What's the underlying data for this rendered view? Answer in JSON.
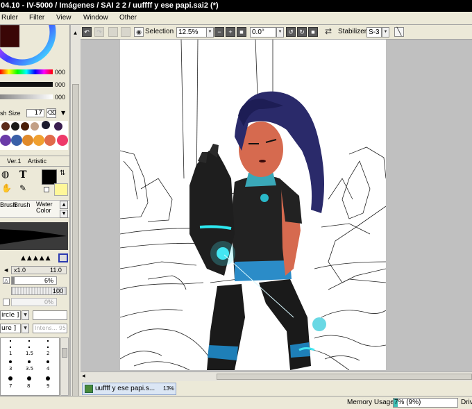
{
  "window": {
    "title": "04.10 - IV-5000 / Imágenes / SAI 2 2 / uuffff y ese papi.sai2 (*)"
  },
  "menu": {
    "items": [
      "Ruler",
      "Filter",
      "View",
      "Window",
      "Other"
    ]
  },
  "toolbar": {
    "selection_label": "Selection",
    "zoom_value": "12.5%",
    "rotation_value": "0.0°",
    "stabilizer_label": "Stabilizer",
    "stabilizer_value": "S-3"
  },
  "color": {
    "slider_values": [
      "000",
      "000",
      "000"
    ],
    "primary": "#000000",
    "secondary": "#fff799"
  },
  "brush": {
    "size_label": "sh Size",
    "size_value": "17",
    "tabs": [
      "Ver.1",
      "Artistic"
    ],
    "tool_names": [
      "Brush",
      "Brush",
      "Water Color"
    ],
    "size_multiplier": "x1.0",
    "size_main": "11.0",
    "min_size": "6%",
    "density": "100",
    "blending_percent": "0%",
    "shape_select": "ircle ]",
    "texture_select": "ure ]",
    "texture_intensity": "Intens... 95"
  },
  "size_grid": {
    "labels": [
      "1",
      "1.5",
      "2",
      "3",
      "3.5",
      "4",
      "7",
      "8",
      "9"
    ]
  },
  "document_tab": {
    "name": "uuffff y ese papi.s...",
    "zoom": "13%"
  },
  "status": {
    "memory_label": "Memory Usage",
    "memory_value": "7% (9%)",
    "memory_fraction": 0.07,
    "drive_label": "Driv"
  }
}
